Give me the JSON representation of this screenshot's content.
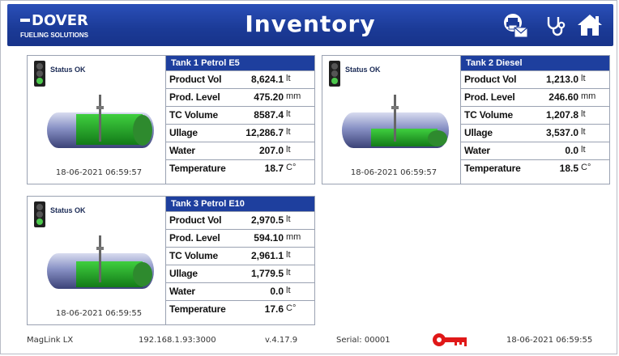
{
  "header": {
    "brand": "DOVER",
    "brand_sub": "FUELING SOLUTIONS",
    "title": "Inventory",
    "icons": [
      "mail-print-icon",
      "stethoscope-icon",
      "home-icon"
    ]
  },
  "tanks": [
    {
      "name": "Tank 1 Petrol E5",
      "status": "Status OK",
      "timestamp": "18-06-2021 06:59:57",
      "rows": [
        {
          "label": "Product Vol",
          "value": "8,624.1",
          "unit": "lt"
        },
        {
          "label": "Prod. Level",
          "value": "475.20",
          "unit": "mm"
        },
        {
          "label": "TC Volume",
          "value": "8587.4",
          "unit": "lt"
        },
        {
          "label": "Ullage",
          "value": "12,286.7",
          "unit": "lt"
        },
        {
          "label": "Water",
          "value": "207.0",
          "unit": "lt"
        },
        {
          "label": "Temperature",
          "value": "18.7",
          "unit": "C°"
        }
      ]
    },
    {
      "name": "Tank 2 Diesel",
      "status": "Status OK",
      "timestamp": "18-06-2021 06:59:57",
      "rows": [
        {
          "label": "Product Vol",
          "value": "1,213.0",
          "unit": "lt"
        },
        {
          "label": "Prod. Level",
          "value": "246.60",
          "unit": "mm"
        },
        {
          "label": "TC Volume",
          "value": "1,207.8",
          "unit": "lt"
        },
        {
          "label": "Ullage",
          "value": "3,537.0",
          "unit": "lt"
        },
        {
          "label": "Water",
          "value": "0.0",
          "unit": "lt"
        },
        {
          "label": "Temperature",
          "value": "18.5",
          "unit": "C°"
        }
      ]
    },
    {
      "name": "Tank 3 Petrol E10",
      "status": "Status OK",
      "timestamp": "18-06-2021 06:59:55",
      "rows": [
        {
          "label": "Product Vol",
          "value": "2,970.5",
          "unit": "lt"
        },
        {
          "label": "Prod. Level",
          "value": "594.10",
          "unit": "mm"
        },
        {
          "label": "TC Volume",
          "value": "2,961.1",
          "unit": "lt"
        },
        {
          "label": "Ullage",
          "value": "1,779.5",
          "unit": "lt"
        },
        {
          "label": "Water",
          "value": "0.0",
          "unit": "lt"
        },
        {
          "label": "Temperature",
          "value": "17.6",
          "unit": "C°"
        }
      ]
    }
  ],
  "footer": {
    "product": "MagLink LX",
    "address": "192.168.1.93:3000",
    "version": "v.4.17.9",
    "serial": "Serial: 00001",
    "key_icon": "key-icon",
    "datetime": "18-06-2021 06:59:55"
  },
  "colors": {
    "header_blue": "#1b3a96",
    "table_header_blue": "#1e3f9e",
    "status_green": "#4cc84c",
    "product_green": "#22a52a",
    "key_red": "#e01818"
  }
}
